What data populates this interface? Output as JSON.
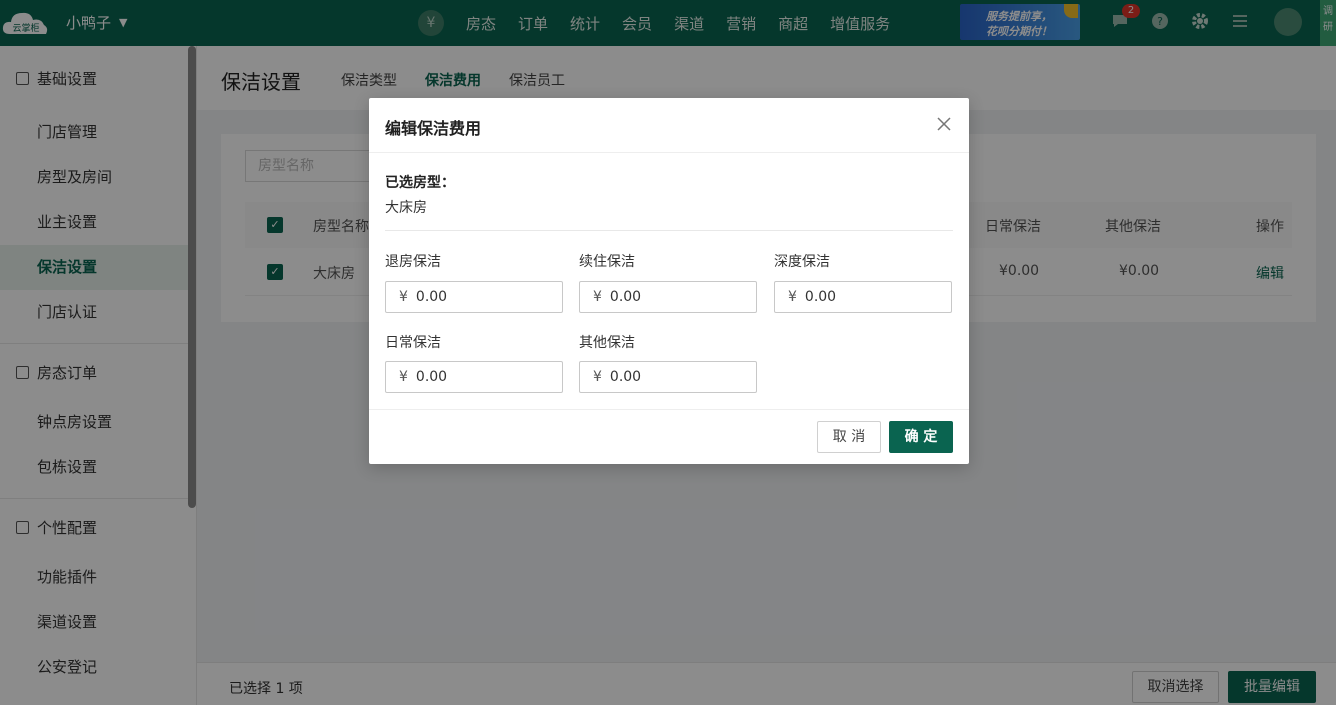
{
  "topbar": {
    "logo_text": "云掌柜",
    "store_name": "小鸭子",
    "nav_currency_icon": "¥",
    "nav": [
      "房态",
      "订单",
      "统计",
      "会员",
      "渠道",
      "营销",
      "商超",
      "增值服务"
    ],
    "banner_line1": "服务提前享，",
    "banner_line2": "花呗分期付！",
    "message_badge": "2",
    "side_tab": "调研"
  },
  "sidebar": {
    "groups": [
      {
        "label": "基础设置",
        "items": [
          "门店管理",
          "房型及房间",
          "业主设置",
          "保洁设置",
          "门店认证"
        ]
      },
      {
        "label": "房态订单",
        "items": [
          "钟点房设置",
          "包栋设置"
        ]
      },
      {
        "label": "个性配置",
        "items": [
          "功能插件",
          "渠道设置",
          "公安登记"
        ]
      }
    ]
  },
  "page": {
    "title": "保洁设置",
    "tabs": [
      "保洁类型",
      "保洁费用",
      "保洁员工"
    ]
  },
  "table": {
    "search_placeholder": "房型名称",
    "headers": {
      "name": "房型名称",
      "daily": "日常保洁",
      "other": "其他保洁",
      "action": "操作"
    },
    "row": {
      "name": "大床房",
      "daily": "¥0.00",
      "other": "¥0.00",
      "action": "编辑"
    }
  },
  "footer": {
    "selected_text": "已选择 1 项",
    "cancel_select": "取消选择",
    "batch_edit": "批量编辑"
  },
  "modal": {
    "title": "编辑保洁费用",
    "selected_label": "已选房型：",
    "selected_value": "大床房",
    "currency": "¥",
    "fields": [
      {
        "label": "退房保洁",
        "value": "0.00"
      },
      {
        "label": "续住保洁",
        "value": "0.00"
      },
      {
        "label": "深度保洁",
        "value": "0.00"
      },
      {
        "label": "日常保洁",
        "value": "0.00"
      },
      {
        "label": "其他保洁",
        "value": "0.00"
      }
    ],
    "cancel": "取 消",
    "confirm": "确 定"
  },
  "colors": {
    "brand": "#0a6450",
    "badge": "#e0352b"
  }
}
